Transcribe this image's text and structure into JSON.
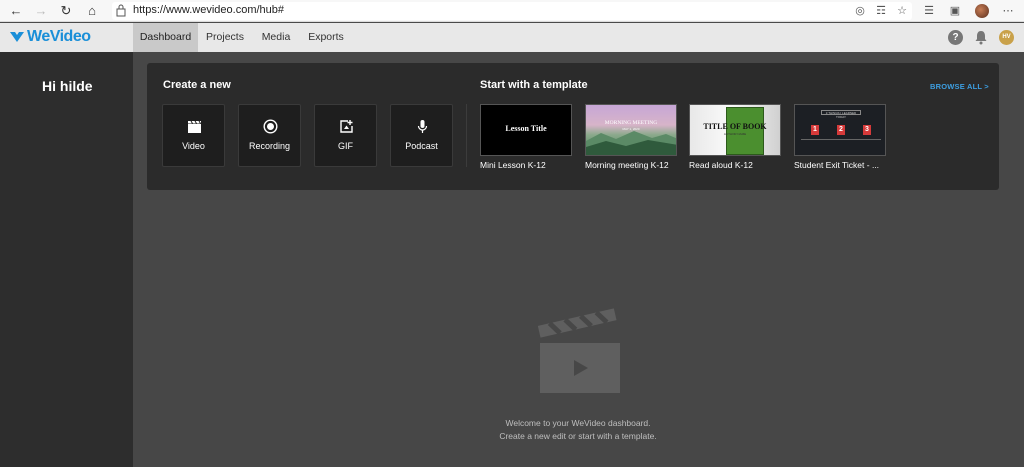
{
  "browser": {
    "url": "https://www.wevideo.com/hub#"
  },
  "app": {
    "logo_text": "WeVideo",
    "nav_tabs": [
      {
        "label": "Dashboard",
        "active": true
      },
      {
        "label": "Projects",
        "active": false
      },
      {
        "label": "Media",
        "active": false
      },
      {
        "label": "Exports",
        "active": false
      }
    ],
    "help_label": "?",
    "avatar_initials": "HV"
  },
  "sidebar": {
    "greeting": "Hi hilde"
  },
  "create": {
    "title": "Create a new",
    "items": [
      {
        "label": "Video",
        "icon": "clapperboard-icon"
      },
      {
        "label": "Recording",
        "icon": "record-icon"
      },
      {
        "label": "GIF",
        "icon": "gif-icon"
      },
      {
        "label": "Podcast",
        "icon": "microphone-icon"
      }
    ]
  },
  "templates": {
    "title": "Start with a template",
    "browse_all": "BROWSE ALL >",
    "items": [
      {
        "label": "Mini Lesson K-12",
        "thumb_title": "Lesson Title"
      },
      {
        "label": "Morning meeting K-12",
        "thumb_title": "MORNING MEETING",
        "thumb_subtitle": "MAY 1, 2020"
      },
      {
        "label": "Read aloud K-12",
        "thumb_title": "TITLE OF BOOK",
        "thumb_subtitle": "AUTHOR NAME"
      },
      {
        "label": "Student Exit Ticket - ...",
        "thumb_header": "3 THINGS I LEARNED TODAY",
        "thumb_numbers": [
          "1",
          "2",
          "3"
        ]
      }
    ]
  },
  "empty_state": {
    "line1": "Welcome to your WeVideo dashboard.",
    "line2": "Create a new edit or start with a template."
  },
  "colors": {
    "brand": "#1a8fd8",
    "link": "#3d9ee0",
    "sidebar_bg": "#2d2d2d",
    "main_bg": "#474747",
    "panel_bg": "#2b2b2b",
    "card_bg": "#1e1e1e"
  }
}
